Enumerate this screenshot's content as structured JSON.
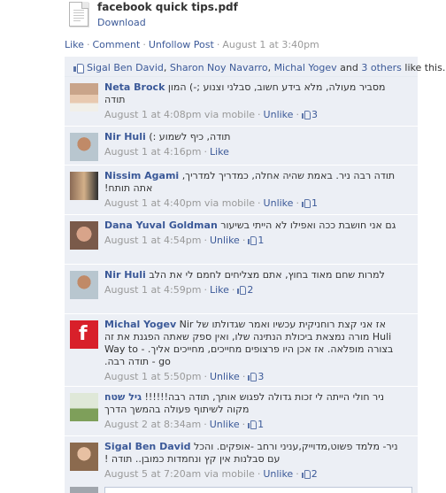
{
  "attachment": {
    "title": "facebook quick tips.pdf",
    "download_label": "Download",
    "icon": "pdf-file-icon"
  },
  "post_actions": {
    "like": "Like",
    "comment": "Comment",
    "unfollow": "Unfollow Post",
    "timestamp": "August 1 at 3:40pm"
  },
  "likes_summary": {
    "names": [
      "Sigal Ben David",
      "Sharon Noy Navarro",
      "Michal Yogev"
    ],
    "and_text": "and",
    "others": "3 others",
    "suffix": "like this."
  },
  "comments": [
    {
      "author": "Neta Brock",
      "text": "מסביר מעולה, מלא בידע חשוב, סבלני וצנוע ;-) המון תודה",
      "time": "August 1 at 4:08pm",
      "via": "via mobile",
      "action": "Unlike",
      "likes": "3"
    },
    {
      "author": "Nir Huli",
      "text": "תודה, כיף לשמוע :)",
      "time": "August 1 at 4:16pm",
      "via": "",
      "action": "Like",
      "likes": ""
    },
    {
      "author": "Nissim Agami",
      "text": "תודה רבה ניר. באמת שהיה אחלה, כמדריך למדריך, אתה תותח!",
      "time": "August 1 at 4:40pm",
      "via": "via mobile",
      "action": "Unlike",
      "likes": "1"
    },
    {
      "author": "Dana Yuval Goldman",
      "text": "גם אני חושבת ככה ואפילו לא הייתי בשיעור",
      "time": "August 1 at 4:54pm",
      "via": "",
      "action": "Unlike",
      "likes": "1"
    },
    {
      "author": "Nir Huli",
      "text": "למרות שחם מאוד בחוץ, אתם מצליחים לחמם לי את הלב",
      "time": "August 1 at 4:59pm",
      "via": "",
      "action": "Like",
      "likes": "2"
    },
    {
      "author": "Michal Yogev",
      "text": "אז אני קצת רוחניקית עכשיו ואמר שגדולתו של Nir Huli מורה נמצאת ביכולת הנתינה שלו, ואין ספק שאתה הפגנת את זה בצורה מופלאה. אז אכן היו פרצופים מחייכים, מחייכים אליך. - Way to go - תודה רבה.",
      "time": "August 1 at 5:50pm",
      "via": "",
      "action": "Unlike",
      "likes": "3"
    },
    {
      "author": "גיל שטח",
      "text": "ניר חולי הייתה לי זכות גדולה לפגוש אותך, תודה רבה!!!!!! מקוה לשיתוף פעולה בהמשך הדרך",
      "time": "August 2 at 8:34am",
      "via": "",
      "action": "Unlike",
      "likes": "1"
    },
    {
      "author": "Sigal Ben David",
      "text": "ניר- מלמד פשוט,מדוייק,עניני ורחב -אופקים. והכל עם סבלנות אין קץ ונחמדות כמובן.. תודה !",
      "time": "August 5 at 7:20am",
      "via": "via mobile",
      "action": "Unlike",
      "likes": "2"
    }
  ],
  "colors": {
    "link": "#3b5998",
    "comment_bg": "#eceff5",
    "meta_text": "#999999"
  }
}
